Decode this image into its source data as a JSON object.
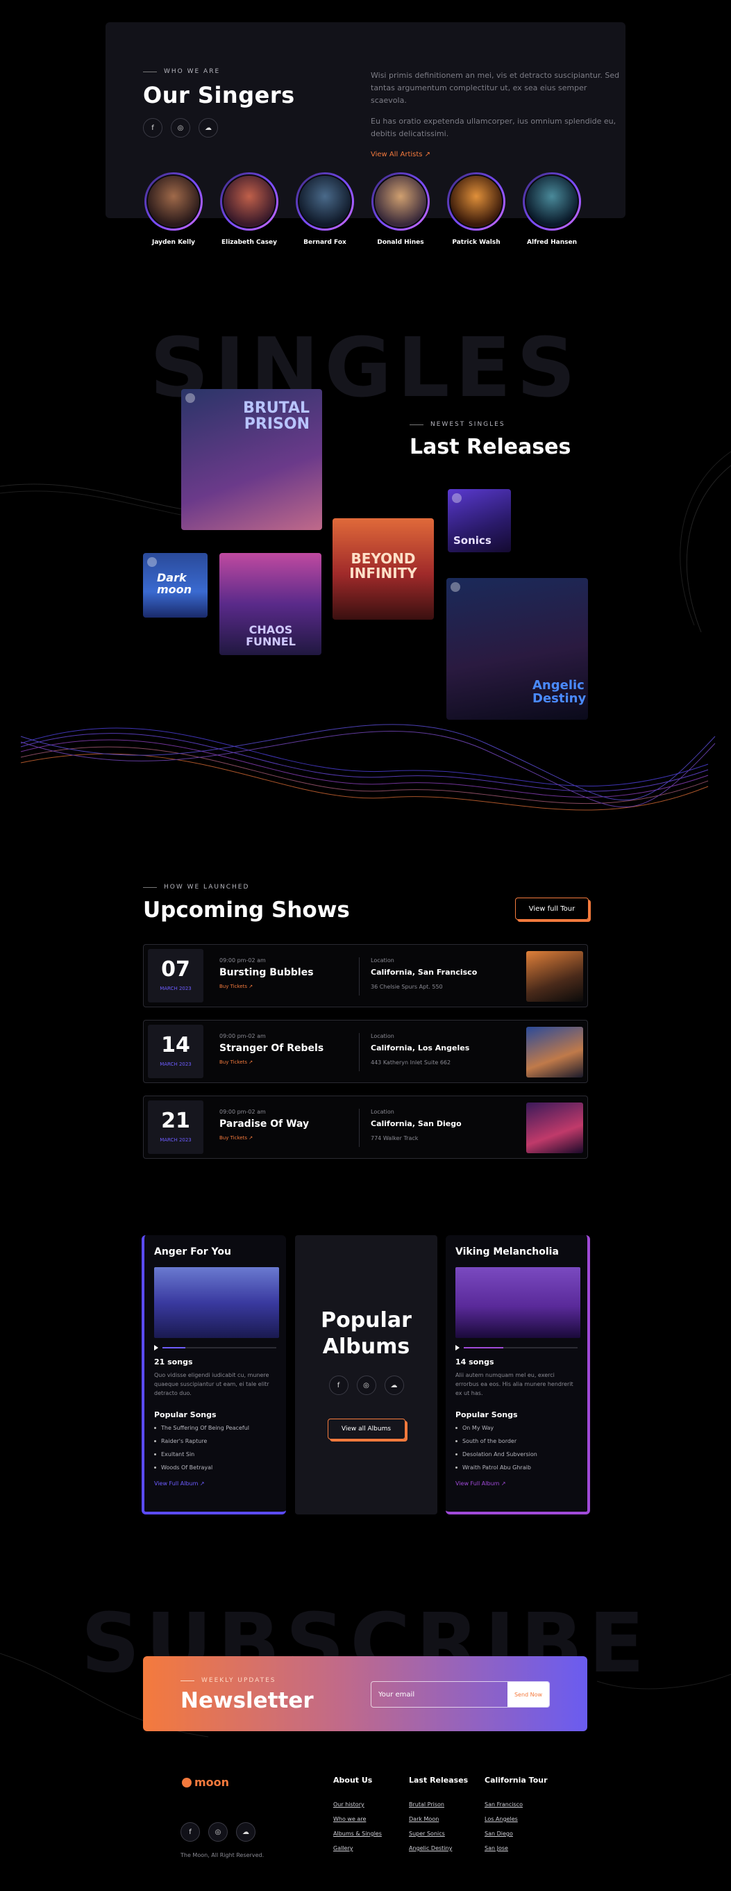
{
  "singers": {
    "eyebrow": "WHO WE ARE",
    "title": "Our Singers",
    "paragraph1": "Wisi primis definitionem an mei, vis et detracto suscipiantur. Sed tantas argumentum complectitur ut, ex sea eius semper scaevola.",
    "paragraph2": "Eu has oratio expetenda ullamcorper, ius omnium splendide eu, debitis delicatissimi.",
    "view_all": "View All Artists  ↗",
    "social": [
      "f",
      "◎",
      "☁"
    ],
    "people": [
      {
        "name": "Jayden Kelly",
        "color": "#7a4a2a"
      },
      {
        "name": "Elizabeth Casey",
        "color": "#8b3a3a"
      },
      {
        "name": "Bernard Fox",
        "color": "#2c4a6a"
      },
      {
        "name": "Donald Hines",
        "color": "#8a6a4a"
      },
      {
        "name": "Patrick Walsh",
        "color": "#a0602a"
      },
      {
        "name": "Alfred Hansen",
        "color": "#2a5a6a"
      }
    ]
  },
  "singles": {
    "background_word": "SINGLES",
    "eyebrow": "NEWEST SINGLES",
    "title": "Last Releases",
    "covers": [
      {
        "title": "BRUTAL PRISON",
        "bg": "linear-gradient(160deg,#2a3568 0%,#6b3a8a 60%,#c06a8a 100%)",
        "color": "#b8c4ff"
      },
      {
        "title": "Dark moon",
        "bg": "linear-gradient(180deg,#2a4a9a 0%,#3a6ad0 60%,#1a2a6a 100%)",
        "color": "#ffffff"
      },
      {
        "title": "CHAOS FUNNEL",
        "bg": "linear-gradient(180deg,#c04aa0 0%,#5a2a8a 50%,#201840 100%)",
        "color": "#cfc8ff"
      },
      {
        "title": "BEYOND INFINITY",
        "bg": "linear-gradient(180deg,#e06a3a 0%,#a02a2a 55%,#3a1010 100%)",
        "color": "#ffe0c8"
      },
      {
        "title": "Sonics",
        "bg": "linear-gradient(160deg,#5a3ad0 0%,#2a1a6a 60%,#140a30 100%)",
        "color": "#e8e0ff"
      },
      {
        "title": "Angelic Destiny",
        "bg": "linear-gradient(170deg,#1a2a5a 0%,#2a1a40 55%,#0a0a1a 100%)",
        "color": "#4a8aff"
      }
    ]
  },
  "shows": {
    "eyebrow": "HOW WE LAUNCHED",
    "title": "Upcoming Shows",
    "tour_button": "View full Tour",
    "location_label": "Location",
    "buy_label": "Buy Tickets  ↗",
    "items": [
      {
        "day": "07",
        "month": "MARCH 2023",
        "time": "09:00 pm-02 am",
        "title": "Bursting Bubbles",
        "city": "California, San Francisco",
        "address": "36 Chelsie Spurs Apt. 550",
        "img": "linear-gradient(160deg,#e0803a,#4a2a1a 60%,#0a0a0a)"
      },
      {
        "day": "14",
        "month": "MARCH 2023",
        "time": "09:00 pm-02 am",
        "title": "Stranger Of Rebels",
        "city": "California, Los Angeles",
        "address": "443 Katheryn Inlet Suite 662",
        "img": "linear-gradient(160deg,#2a4a9a,#c07a4a 60%,#1a1a2a)"
      },
      {
        "day": "21",
        "month": "MARCH 2023",
        "time": "09:00 pm-02 am",
        "title": "Paradise Of Way",
        "city": "California, San Diego",
        "address": "774 Walker Track",
        "img": "linear-gradient(160deg,#3a1a5a,#c03a6a 60%,#1a0a2a)"
      }
    ]
  },
  "albums": {
    "left": {
      "title": "Anger For You",
      "songs": "21 songs",
      "desc": "Quo vidisse eligendi iudicabit cu, munere quaeque suscipiantur ut eam, ei tale elitr detracto duo.",
      "popular": "Popular Songs",
      "list": [
        "The Suffering Of Being Peaceful",
        "Raider's Rapture",
        "Exultant Sin",
        "Woods Of Betrayal"
      ],
      "more": "View Full Album  ↗",
      "accent": "#5b4bff",
      "img": "linear-gradient(180deg,#6a7ad0 0%,#3a3aa0 50%,#1a1a50 100%)",
      "progress": 0.2
    },
    "center": {
      "title_line1": "Popular",
      "title_line2": "Albums",
      "button": "View all Albums"
    },
    "right": {
      "title": "Viking Melancholia",
      "songs": "14 songs",
      "desc": "Alii autem numquam mel eu, exerci errorbus ea eos. His alia munere hendrerit ex ut has.",
      "popular": "Popular Songs",
      "list": [
        "On My Way",
        "South of the border",
        "Desolation And Subversion",
        "Wraith Patrol Abu Ghraib"
      ],
      "more": "View Full Album  ↗",
      "accent": "#a04ad8",
      "img": "linear-gradient(180deg,#7a4ac0 0%,#5a2a9a 55%,#1a0a3a 100%)",
      "progress": 0.35
    }
  },
  "subscribe": {
    "background_word": "SUBSCRIBE",
    "eyebrow": "WEEKLY UPDATES",
    "title": "Newsletter",
    "placeholder": "Your email",
    "send": "Send Now"
  },
  "footer": {
    "logo": "moon",
    "copyright": "The Moon, All Right Reserved.",
    "cols": [
      {
        "title": "About Us",
        "links": [
          "Our history",
          "Who we are",
          "Albums & Singles",
          "Gallery"
        ]
      },
      {
        "title": "Last Releases",
        "links": [
          "Brutal Prison",
          "Dark Moon",
          "Super Sonics",
          "Angelic Destiny"
        ]
      },
      {
        "title": "California Tour",
        "links": [
          "San Francisco",
          "Los Angeles",
          "San Diego",
          "San Jose"
        ]
      }
    ]
  }
}
